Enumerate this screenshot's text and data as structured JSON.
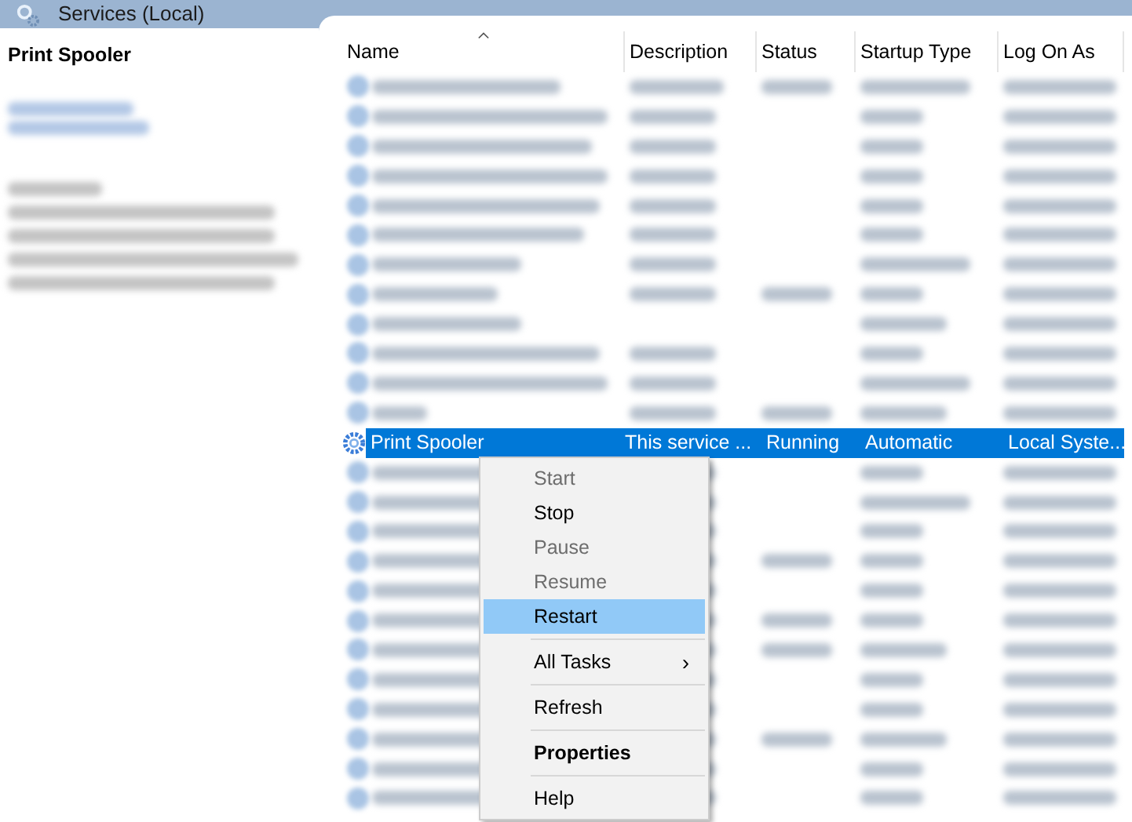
{
  "header": {
    "title": "Services (Local)"
  },
  "detail": {
    "title": "Print Spooler"
  },
  "table": {
    "columns": [
      {
        "label": "Name",
        "sorted": true
      },
      {
        "label": "Description",
        "sorted": false
      },
      {
        "label": "Status",
        "sorted": false
      },
      {
        "label": "Startup Type",
        "sorted": false
      },
      {
        "label": "Log On As",
        "sorted": false
      }
    ],
    "selected_row": {
      "name": "Print Spooler",
      "description": "This service ...",
      "status": "Running",
      "startup_type": "Automatic",
      "log_on_as": "Local Syste...",
      "selected": true
    }
  },
  "context_menu": {
    "items": [
      {
        "kind": "item",
        "label": "Start",
        "disabled": true,
        "selected": false,
        "bold": false
      },
      {
        "kind": "item",
        "label": "Stop",
        "disabled": false,
        "selected": false,
        "bold": false
      },
      {
        "kind": "item",
        "label": "Pause",
        "disabled": true,
        "selected": false,
        "bold": false
      },
      {
        "kind": "item",
        "label": "Resume",
        "disabled": true,
        "selected": false,
        "bold": false
      },
      {
        "kind": "item",
        "label": "Restart",
        "disabled": false,
        "selected": true,
        "bold": false
      },
      {
        "kind": "separator"
      },
      {
        "kind": "submenu",
        "label": "All Tasks",
        "disabled": false,
        "selected": false,
        "bold": false,
        "arrow": "›"
      },
      {
        "kind": "separator"
      },
      {
        "kind": "item",
        "label": "Refresh",
        "disabled": false,
        "selected": false,
        "bold": false
      },
      {
        "kind": "separator"
      },
      {
        "kind": "item",
        "label": "Properties",
        "disabled": false,
        "selected": false,
        "bold": true
      },
      {
        "kind": "separator"
      },
      {
        "kind": "item",
        "label": "Help",
        "disabled": false,
        "selected": false,
        "bold": false
      }
    ]
  }
}
